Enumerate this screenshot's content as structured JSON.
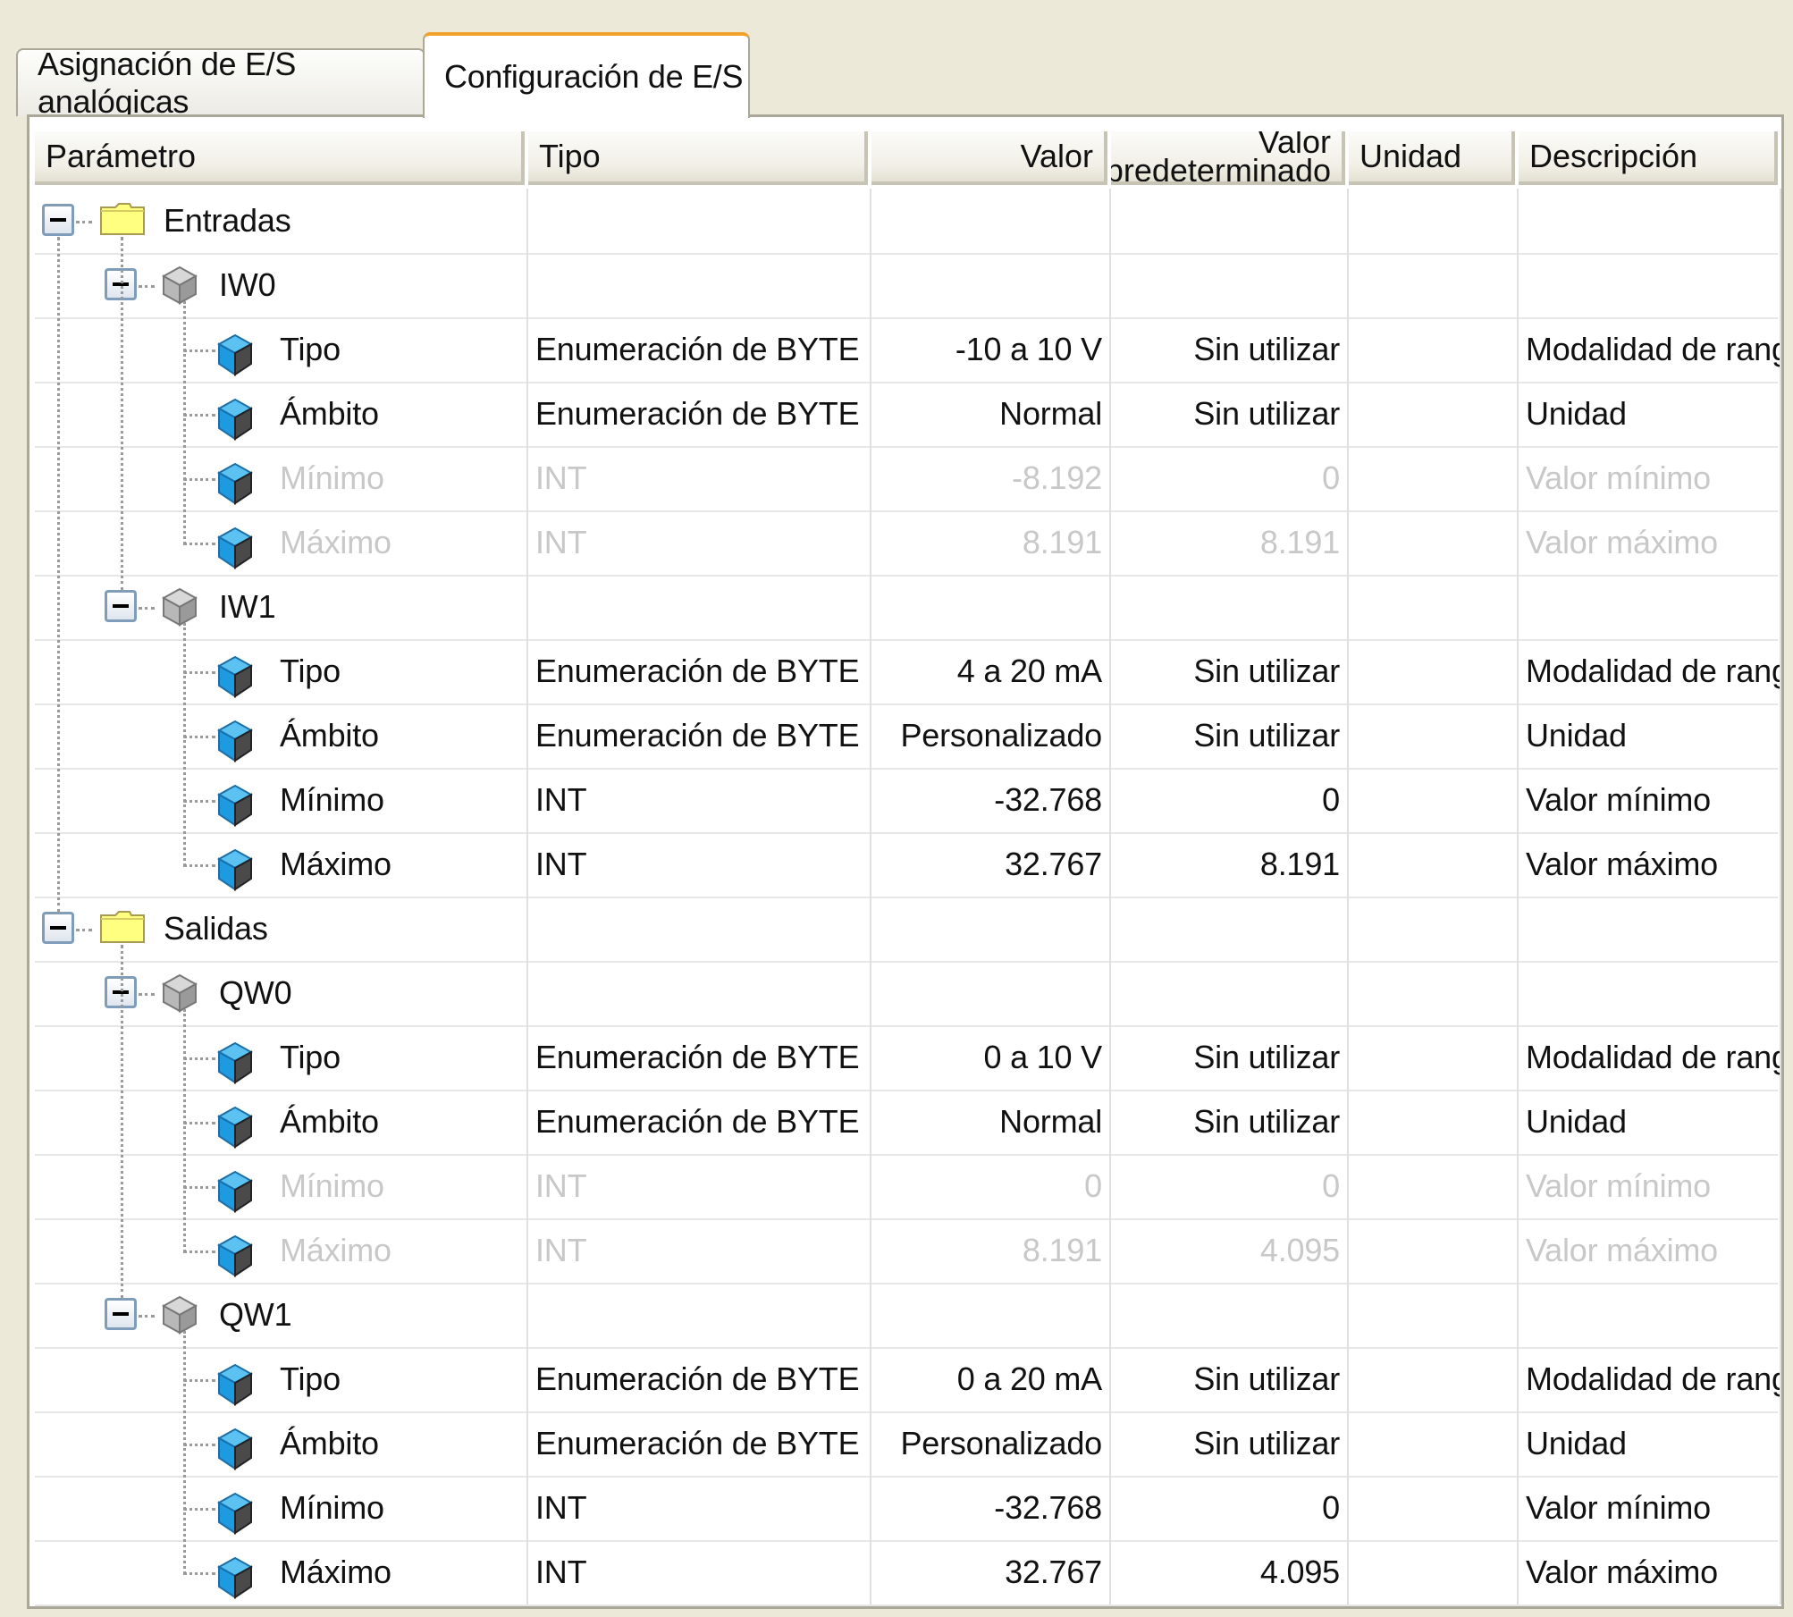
{
  "tabs": [
    {
      "label": "Asignación de E/S analógicas",
      "active": false
    },
    {
      "label": "Configuración de E/S",
      "active": true
    }
  ],
  "columns": {
    "parametro": "Parámetro",
    "tipo": "Tipo",
    "valor": "Valor",
    "valor_pred_1": "Valor",
    "valor_pred_2": "predeterminado",
    "unidad": "Unidad",
    "descripcion": "Descripción"
  },
  "colors": {
    "accent_tab": "#f2a12b",
    "folder": "#ffff80",
    "leaf_icon": "#1e9ae0",
    "disabled_text": "#c8c8c8"
  },
  "rows": [
    {
      "level": 0,
      "kind": "folder",
      "name": "Entradas"
    },
    {
      "level": 1,
      "kind": "device",
      "name": "IW0"
    },
    {
      "level": 2,
      "kind": "param",
      "name": "Tipo",
      "tipo": "Enumeración de BYTE",
      "valor": "-10 a 10 V",
      "predeterminado": "Sin utilizar",
      "unidad": "",
      "descripcion": "Modalidad de rango",
      "enabled": true
    },
    {
      "level": 2,
      "kind": "param",
      "name": "Ámbito",
      "tipo": "Enumeración de BYTE",
      "valor": "Normal",
      "predeterminado": "Sin utilizar",
      "unidad": "",
      "descripcion": "Unidad",
      "enabled": true
    },
    {
      "level": 2,
      "kind": "param",
      "name": "Mínimo",
      "tipo": "INT",
      "valor": "-8.192",
      "predeterminado": "0",
      "unidad": "",
      "descripcion": "Valor mínimo",
      "enabled": false
    },
    {
      "level": 2,
      "kind": "param",
      "name": "Máximo",
      "tipo": "INT",
      "valor": "8.191",
      "predeterminado": "8.191",
      "unidad": "",
      "descripcion": "Valor máximo",
      "enabled": false
    },
    {
      "level": 1,
      "kind": "device",
      "name": "IW1"
    },
    {
      "level": 2,
      "kind": "param",
      "name": "Tipo",
      "tipo": "Enumeración de BYTE",
      "valor": "4 a 20 mA",
      "predeterminado": "Sin utilizar",
      "unidad": "",
      "descripcion": "Modalidad de rango",
      "enabled": true
    },
    {
      "level": 2,
      "kind": "param",
      "name": "Ámbito",
      "tipo": "Enumeración de BYTE",
      "valor": "Personalizado",
      "predeterminado": "Sin utilizar",
      "unidad": "",
      "descripcion": "Unidad",
      "enabled": true
    },
    {
      "level": 2,
      "kind": "param",
      "name": "Mínimo",
      "tipo": "INT",
      "valor": "-32.768",
      "predeterminado": "0",
      "unidad": "",
      "descripcion": "Valor mínimo",
      "enabled": true
    },
    {
      "level": 2,
      "kind": "param",
      "name": "Máximo",
      "tipo": "INT",
      "valor": "32.767",
      "predeterminado": "8.191",
      "unidad": "",
      "descripcion": "Valor máximo",
      "enabled": true
    },
    {
      "level": 0,
      "kind": "folder",
      "name": "Salidas"
    },
    {
      "level": 1,
      "kind": "device",
      "name": "QW0"
    },
    {
      "level": 2,
      "kind": "param",
      "name": "Tipo",
      "tipo": "Enumeración de BYTE",
      "valor": "0 a 10 V",
      "predeterminado": "Sin utilizar",
      "unidad": "",
      "descripcion": "Modalidad de rango",
      "enabled": true
    },
    {
      "level": 2,
      "kind": "param",
      "name": "Ámbito",
      "tipo": "Enumeración de BYTE",
      "valor": "Normal",
      "predeterminado": "Sin utilizar",
      "unidad": "",
      "descripcion": "Unidad",
      "enabled": true
    },
    {
      "level": 2,
      "kind": "param",
      "name": "Mínimo",
      "tipo": "INT",
      "valor": "0",
      "predeterminado": "0",
      "unidad": "",
      "descripcion": "Valor mínimo",
      "enabled": false
    },
    {
      "level": 2,
      "kind": "param",
      "name": "Máximo",
      "tipo": "INT",
      "valor": "8.191",
      "predeterminado": "4.095",
      "unidad": "",
      "descripcion": "Valor máximo",
      "enabled": false
    },
    {
      "level": 1,
      "kind": "device",
      "name": "QW1"
    },
    {
      "level": 2,
      "kind": "param",
      "name": "Tipo",
      "tipo": "Enumeración de BYTE",
      "valor": "0 a 20 mA",
      "predeterminado": "Sin utilizar",
      "unidad": "",
      "descripcion": "Modalidad de rango",
      "enabled": true
    },
    {
      "level": 2,
      "kind": "param",
      "name": "Ámbito",
      "tipo": "Enumeración de BYTE",
      "valor": "Personalizado",
      "predeterminado": "Sin utilizar",
      "unidad": "",
      "descripcion": "Unidad",
      "enabled": true
    },
    {
      "level": 2,
      "kind": "param",
      "name": "Mínimo",
      "tipo": "INT",
      "valor": "-32.768",
      "predeterminado": "0",
      "unidad": "",
      "descripcion": "Valor mínimo",
      "enabled": true
    },
    {
      "level": 2,
      "kind": "param",
      "name": "Máximo",
      "tipo": "INT",
      "valor": "32.767",
      "predeterminado": "4.095",
      "unidad": "",
      "descripcion": "Valor máximo",
      "enabled": true
    }
  ]
}
